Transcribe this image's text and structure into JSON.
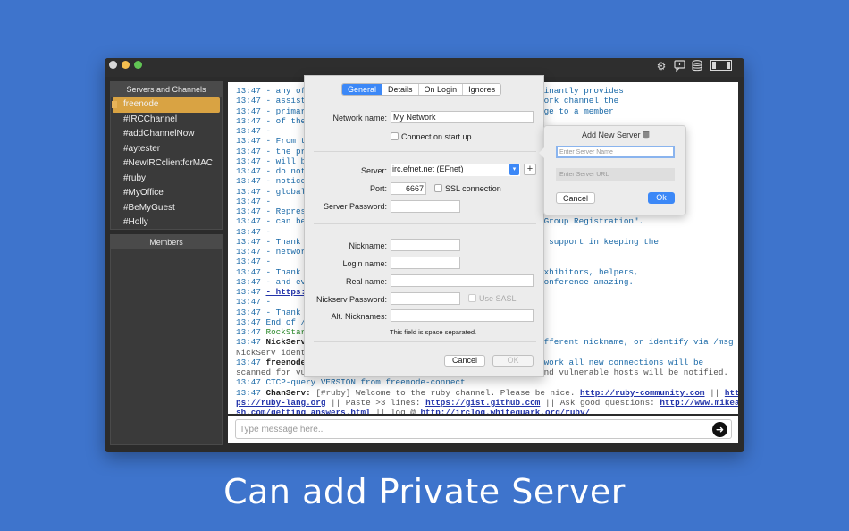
{
  "window": {
    "toolbar_icons": [
      "gear-icon",
      "chat-bubble-icon",
      "database-icon",
      "layout-panels-icon"
    ]
  },
  "sidebar": {
    "channels_header": "Servers and Channels",
    "channels": [
      "freenode",
      "#IRCChannel",
      "#addChannelNow",
      "#aytester",
      "#NewIRCclientforMAC",
      "#ruby",
      "#MyOffice",
      "#BeMyGuest",
      "#Holly"
    ],
    "selected_channel": "freenode",
    "members_header": "Members"
  },
  "chat": {
    "lines": [
      {
        "time": "13:47",
        "left": "- any of",
        "right": "minantly provides"
      },
      {
        "time": "13:47",
        "left": "- assist",
        "right": "work channel the"
      },
      {
        "time": "13:47",
        "left": "- primar",
        "right": "age to a member"
      },
      {
        "time": "13:47",
        "left": "- of the",
        "right": ""
      },
      {
        "time": "13:47",
        "left": "-",
        "right": ""
      },
      {
        "time": "13:47",
        "left": "- From t",
        "right": ""
      },
      {
        "time": "13:47",
        "left": "- the pr",
        "right": ""
      },
      {
        "time": "13:47",
        "left": "- will b",
        "right": ""
      },
      {
        "time": "13:47",
        "left": "- do not",
        "right": ""
      },
      {
        "time": "13:47",
        "left": "- notice",
        "right": ""
      },
      {
        "time": "13:47",
        "left": "- global",
        "right": ""
      },
      {
        "time": "13:47",
        "left": "-",
        "right": ""
      },
      {
        "time": "13:47",
        "left": "- Repres",
        "right": ""
      },
      {
        "time": "13:47",
        "left": "- can be",
        "right": "\"Group Registration\"."
      },
      {
        "time": "13:47",
        "left": "-",
        "right": ""
      },
      {
        "time": "13:47",
        "left": "- Thank",
        "right": "d support in keeping the"
      },
      {
        "time": "13:47",
        "left": "- networ",
        "right": ""
      },
      {
        "time": "13:47",
        "left": "-",
        "right": ""
      },
      {
        "time": "13:47",
        "left": "- Thank",
        "right": "exhibitors, helpers,"
      },
      {
        "time": "13:47",
        "left": "- and ev",
        "right": "conference amazing."
      },
      {
        "time": "13:47",
        "left": "- https:",
        "right": ""
      },
      {
        "time": "13:47",
        "left": "-",
        "right": ""
      },
      {
        "time": "13:47",
        "left": "- Thank",
        "right": ""
      },
      {
        "time": "13:47",
        "left": "End of /",
        "right": ""
      },
      {
        "time": "13:47",
        "left": "RockStar",
        "right": ""
      },
      {
        "time": "13:47",
        "left": "NickServ",
        "right": "ifferent nickname, or identify via /msg"
      }
    ],
    "nickserv_ident": "NickServ ident",
    "freenode_line": {
      "time": "13:47",
      "nick": "freenode",
      "right": "twork all new connections will be"
    },
    "scanned_line": "scanned for vu",
    "scanned_right": "and vulnerable hosts will be notified.",
    "ctcp_line": "13:47 CTCP-query VERSION from freenode-connect",
    "chanserv": {
      "time": "13:47",
      "nick": "ChanServ:",
      "text": "[#ruby] Welcome to the ruby channel. Please be nice.",
      "link1": "http://ruby-community.com",
      "sep": "||",
      "link2": "htt",
      "line2_start": "ps://ruby-lang.org",
      "line2_mid": "|| Paste >3 lines:",
      "link3": "https://gist.github.com",
      "line2_mid2": "|| Ask good questions:",
      "link4": "http://www.mikea",
      "line3_start": "sh.com/getting_answers.html",
      "line3_mid": "|| log @",
      "link5": "http://irclog.whitequark.org/ruby/"
    }
  },
  "message_bar": {
    "placeholder": "Type message here..",
    "send_icon": "arrow-right-icon"
  },
  "settings_dialog": {
    "tabs": [
      "General",
      "Details",
      "On Login",
      "Ignores"
    ],
    "active_tab": "General",
    "network_name_label": "Network name:",
    "network_name_value": "My Network",
    "connect_on_startup_label": "Connect on start up",
    "server_label": "Server:",
    "server_value": "irc.efnet.net (EFnet)",
    "add_server_icon": "+",
    "port_label": "Port:",
    "port_value": "6667",
    "ssl_label": "SSL connection",
    "server_password_label": "Server Password:",
    "nickname_label": "Nickname:",
    "login_name_label": "Login name:",
    "real_name_label": "Real name:",
    "nickserv_password_label": "Nickserv Password:",
    "use_sasl_label": "Use SASL",
    "alt_nicknames_label": "Alt. Nicknames:",
    "alt_nicknames_hint": "This field is space separated.",
    "cancel_label": "Cancel",
    "ok_label": "OK"
  },
  "add_server_popover": {
    "title": "Add New Server",
    "title_icon": "database-icon",
    "name_placeholder": "Enter Server Name",
    "url_placeholder": "Enter Server URL",
    "cancel_label": "Cancel",
    "ok_label": "Ok",
    "ok_color": "#3c88f7"
  },
  "caption": "Can add Private Server"
}
